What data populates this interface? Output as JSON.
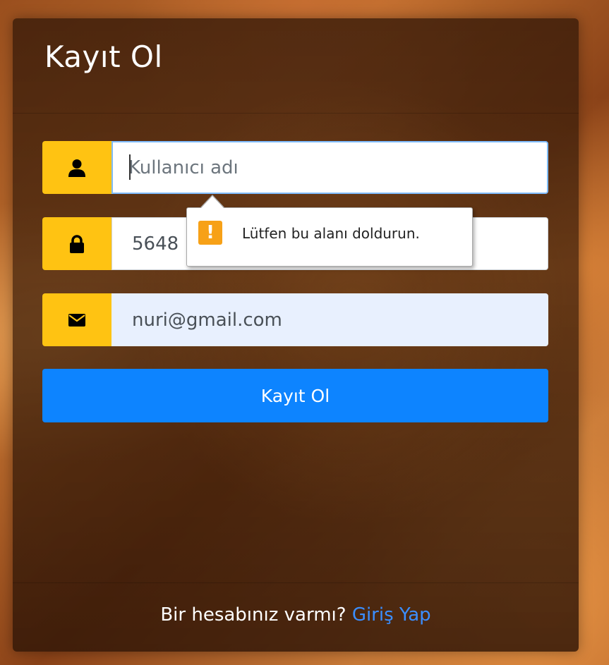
{
  "form": {
    "title": "Kayıt Ol",
    "username": {
      "placeholder": "Kullanıcı adı",
      "value": "",
      "icon": "user-icon"
    },
    "password": {
      "value": "5648",
      "icon": "lock-icon"
    },
    "email": {
      "value": "nuri@gmail.com",
      "icon": "envelope-icon"
    },
    "submit_label": "Kayıt Ol"
  },
  "validation_tooltip": {
    "message": "Lütfen bu alanı doldurun.",
    "icon_glyph": "!",
    "icon": "warning-icon"
  },
  "footer": {
    "prompt": "Bir hesabınız varmı?",
    "link_label": "Giriş Yap"
  },
  "colors": {
    "addon": "#ffc312",
    "button": "#0d84ff",
    "link": "#3b8eff",
    "warning": "#f7a117"
  }
}
